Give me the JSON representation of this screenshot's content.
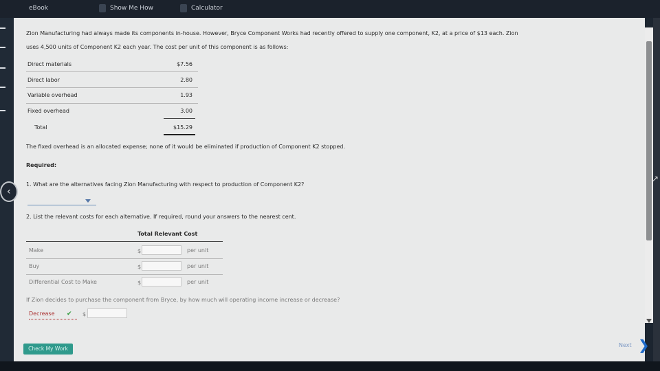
{
  "topbar": {
    "ebook": "eBook",
    "show_me_how": "Show Me How",
    "calculator": "Calculator"
  },
  "problem": {
    "intro_line1": "Zion Manufacturing had always made its components in-house. However, Bryce Component Works had recently offered to supply one component, K2, at a price of $13 each. Zion",
    "intro_line2": "uses 4,500 units of Component K2 each year. The cost per unit of this component is as follows:",
    "cost_rows": [
      {
        "label": "Direct materials",
        "value": "$7.56"
      },
      {
        "label": "Direct labor",
        "value": "2.80"
      },
      {
        "label": "Variable overhead",
        "value": "1.93"
      },
      {
        "label": "Fixed overhead",
        "value": "3.00"
      }
    ],
    "total_label": "Total",
    "total_value": "$15.29",
    "fixed_note": "The fixed overhead is an allocated expense; none of it would be eliminated if production of Component K2 stopped.",
    "required": "Required:"
  },
  "q1": {
    "text": "1. What are the alternatives facing Zion Manufacturing with respect to production of Component K2?",
    "dropdown_value": ""
  },
  "q2": {
    "text": "2. List the relevant costs for each alternative. If required, round your answers to the nearest cent.",
    "header": "Total Relevant Cost",
    "rows": [
      {
        "label": "Make",
        "currency": "$",
        "value": "",
        "unit": "per unit"
      },
      {
        "label": "Buy",
        "currency": "$",
        "value": "",
        "unit": "per unit"
      },
      {
        "label": "Differential Cost to Make",
        "currency": "$",
        "value": "",
        "unit": "per unit"
      }
    ],
    "income_question": "If Zion decides to purchase the component from Bryce, by how much will operating income increase or decrease?",
    "income_choice": "Decrease",
    "income_currency": "$",
    "income_value": ""
  },
  "footer": {
    "check_my_work": "Check My Work",
    "next": "Next"
  },
  "icons": {
    "back": "chevron-left-icon",
    "next": "chevron-right-icon",
    "check": "check-icon"
  },
  "colors": {
    "accent_teal": "#2f9a8c",
    "link_blue": "#1e6ac9",
    "check_green": "#2e9a3a"
  }
}
